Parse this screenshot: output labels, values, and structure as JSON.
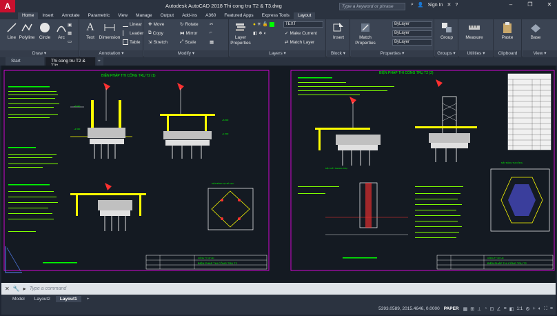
{
  "app": {
    "title": "Autodesk AutoCAD 2018    Thi cong tru T2 & T3.dwg",
    "logo": "A",
    "search_placeholder": "Type a keyword or phrase",
    "sign_in": "Sign In",
    "window_buttons": [
      "–",
      "❐",
      "✕"
    ]
  },
  "ribbon_tabs": [
    "Home",
    "Insert",
    "Annotate",
    "Parametric",
    "View",
    "Manage",
    "Output",
    "Add-ins",
    "A360",
    "Featured Apps",
    "Express Tools",
    "Layout"
  ],
  "ribbon": {
    "draw": {
      "title": "Draw ▾",
      "line": "Line",
      "polyline": "Polyline",
      "circle": "Circle",
      "arc": "Arc"
    },
    "annotation": {
      "title": "Annotation ▾",
      "text": "Text",
      "dimension": "Dimension",
      "linear": "Linear",
      "leader": "Leader",
      "table": "Table"
    },
    "modify": {
      "title": "Modify ▾",
      "move": "Move",
      "rotate": "Rotate",
      "copy": "Copy",
      "mirror": "Mirror",
      "stretch": "Stretch",
      "scale": "Scale"
    },
    "layers": {
      "title": "Layers ▾",
      "layer_properties": "Layer Properties",
      "current_layer": "TEXT",
      "make_current": "Make Current",
      "match_layer": "Match Layer"
    },
    "block": {
      "title": "Block ▾",
      "insert": "Insert"
    },
    "properties": {
      "title": "Properties ▾",
      "match_properties": "Match Properties",
      "color": "ByLayer",
      "linetype": "ByLayer",
      "lineweight": "ByLayer"
    },
    "groups": {
      "title": "Groups ▾",
      "group": "Group"
    },
    "utilities": {
      "title": "Utilities ▾",
      "measure": "Measure"
    },
    "clipboard": {
      "title": "Clipboard",
      "paste": "Paste"
    },
    "view": {
      "title": "View ▾",
      "base": "Base"
    }
  },
  "file_tabs": [
    "Start",
    "Thi cong tru T2 & T3*"
  ],
  "drawing": {
    "sheet1_title": "BIỆN PHÁP THI CÔNG TRỤ T2 (1)",
    "sheet2_title": "BIỆN PHÁP THI CÔNG TRỤ T2 (2)",
    "sheet1_footer": "BIỆN PHÁP THI CÔNG TRỤ T2",
    "sheet2_footer": "BIỆN PHÁP THI CÔNG TRỤ T2",
    "footer_small": "CÔNG TY CP HC"
  },
  "command": {
    "placeholder": "Type a command"
  },
  "layout_tabs": [
    "Model",
    "Layout2",
    "Layout1"
  ],
  "status": {
    "coords": "5393.0589, 2015.4646, 0.0000",
    "space": "PAPER",
    "scale": "1:1"
  },
  "colors": {
    "accent_red": "#c8102e",
    "canvas": "#141a22",
    "ribbon": "#3b4453",
    "line_green": "#00ff00",
    "line_yellow": "#ffff00",
    "line_magenta": "#ff00ff"
  }
}
